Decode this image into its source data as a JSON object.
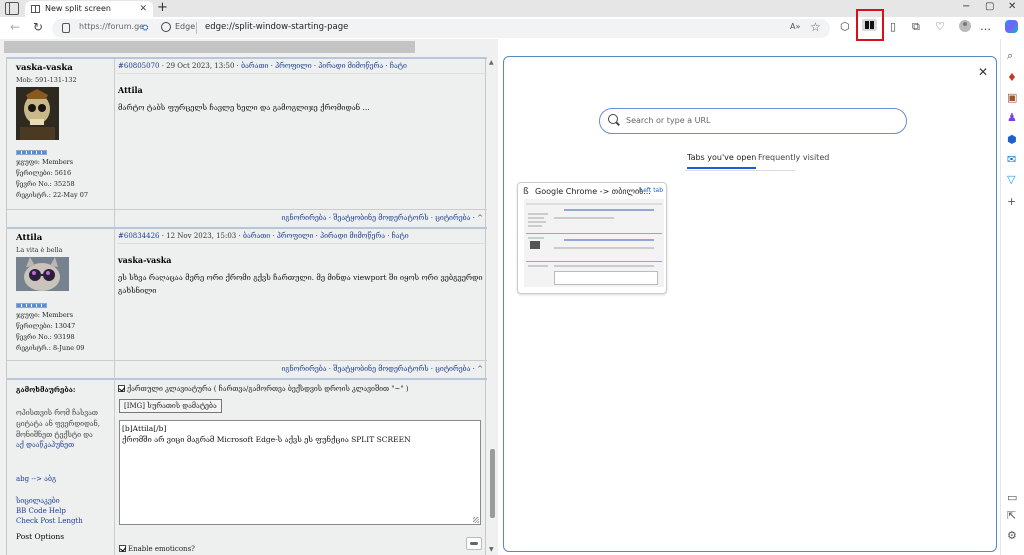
{
  "browser": {
    "tab_title": "New split screen",
    "new_tab_glyph": "+",
    "window_controls": [
      "−",
      "▢",
      "✕"
    ],
    "url_left": "https://forum.ge",
    "url_site_label": "Edge",
    "url": "edge://split-window-starting-page"
  },
  "forum": {
    "posts": [
      {
        "username": "vaska-vaska",
        "subline": "Mob: 591-131-132",
        "info": [
          "ჯგუფი: Members",
          "წერილები: 5616",
          "წევრი No.: 35258",
          "რეგისტრ.: 22-May 07"
        ],
        "post_id": "#60805070",
        "date": " · 29 Oct 2023, 13:50 · ",
        "links": "ბარათი · პროფილი · პირადი მიმოწერა · ჩატი",
        "quote_author": "Attila",
        "text": "მარტო ტაბს ფურცელს ჩავლე ხელი და გამოგლიჯე ქრომიდან ...",
        "actions": "იგნორირება · შეატყობინე მოდერატორს · ციტირება · ^"
      },
      {
        "username": "Attila",
        "subline": "La vita è bella",
        "info": [
          "ჯგუფი: Members",
          "წერილები: 13047",
          "წევრი No.: 93198",
          "რეგისტრ.: 8-June 09"
        ],
        "post_id": "#60834426",
        "date": " · 12 Nov 2023, 15:03 · ",
        "links": "ბარათი · პროფილი · პირადი მიმოწერა · ჩატი",
        "quote_author": "vaska-vaska",
        "text": "ეს სხვა რაღაცაა მერე ორი ქრომი გქვს ჩართული. მე მინდა viewport ში იყოს ორი ვებგვერდი გახსნილი",
        "actions": "იგნორირება · შეატყობინე მოდერატორს · ციტირება · ^"
      }
    ],
    "reply": {
      "label": "გამოხმაურება:",
      "hint": "ოპისთვის რომ ჩასვათ ციტატა ან ფვერდიდან, მონიშნეთ ტექსტი და",
      "hint_link": "აქ დააწკაპუნეთ",
      "translit": "abg --> აბგ",
      "help_links": [
        "სიცილაკები",
        "BB Code Help",
        "Check Post Length"
      ],
      "post_options": "Post Options",
      "checkbox_label": "ქართული კლავიატურა ( ჩართვა/გამორთვა ბექსდვის დროის კლავიშით \"~\" )",
      "img_button": "[IMG] სურათის დამატება",
      "text_line1": "[b]Attila[/b]",
      "text_line2": "ქრომში არ ვიცი მაგრამ Microsoft Edge-ს აქვს ეს ფუნქცია SPLIT SCREEN",
      "emoticons": "Enable emoticons?"
    }
  },
  "split": {
    "search_placeholder": "Search or type a URL",
    "tab_open": "Tabs you've open",
    "tab_frequent": "Frequently visited",
    "card_title": "Google Chrome -> თბილის...",
    "card_badge": "Left tab"
  },
  "colors": {
    "highlight": "#d8101c",
    "accent": "#1d5fd1",
    "forum_link": "#1d3d8f"
  }
}
